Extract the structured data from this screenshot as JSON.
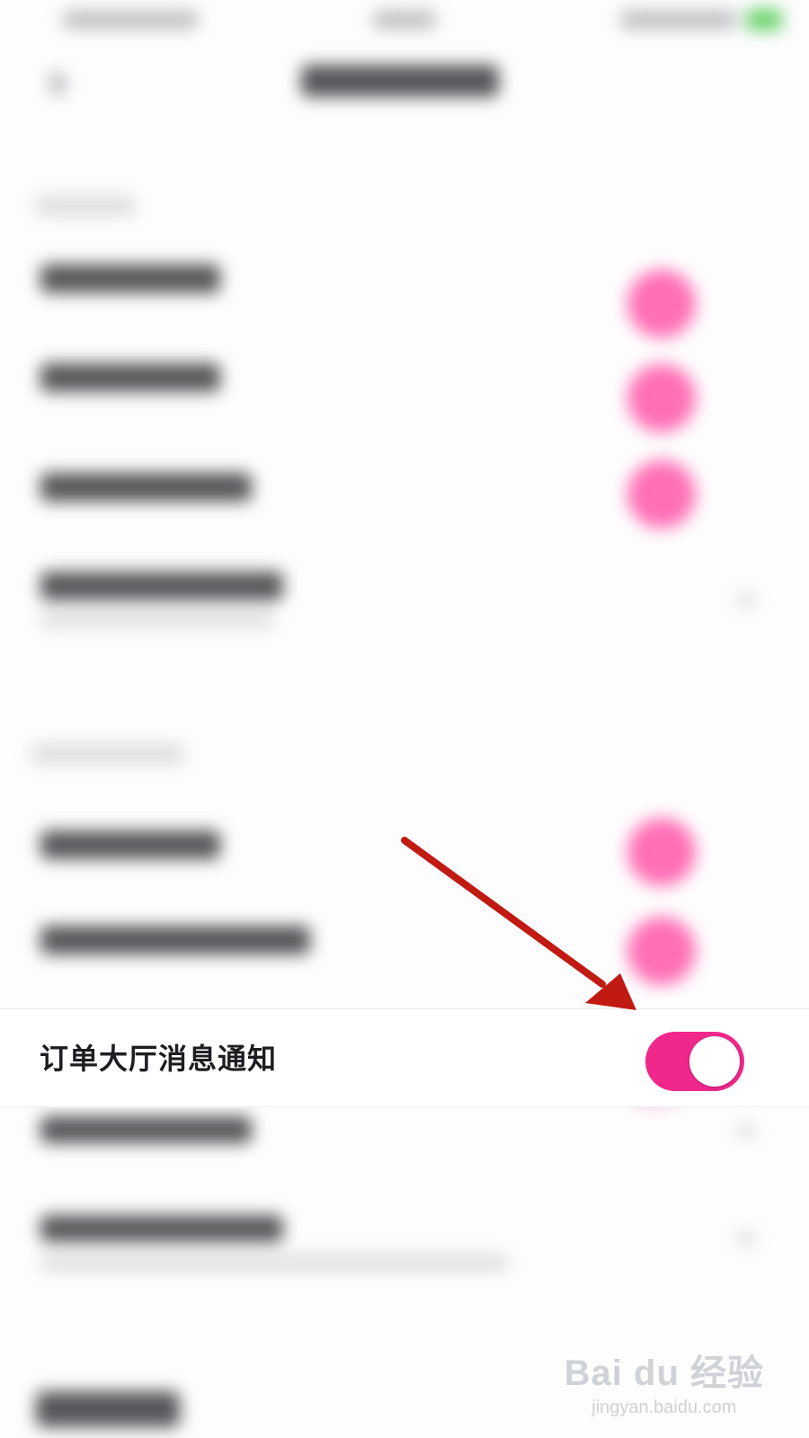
{
  "focus_row": {
    "label": "订单大厅消息通知",
    "toggle_on": true,
    "toggle_color": "#f0288c"
  },
  "annotation": {
    "arrow_color": "#c01a12"
  },
  "watermark": {
    "logo": "Bai du 经验",
    "url": "jingyan.baidu.com"
  }
}
